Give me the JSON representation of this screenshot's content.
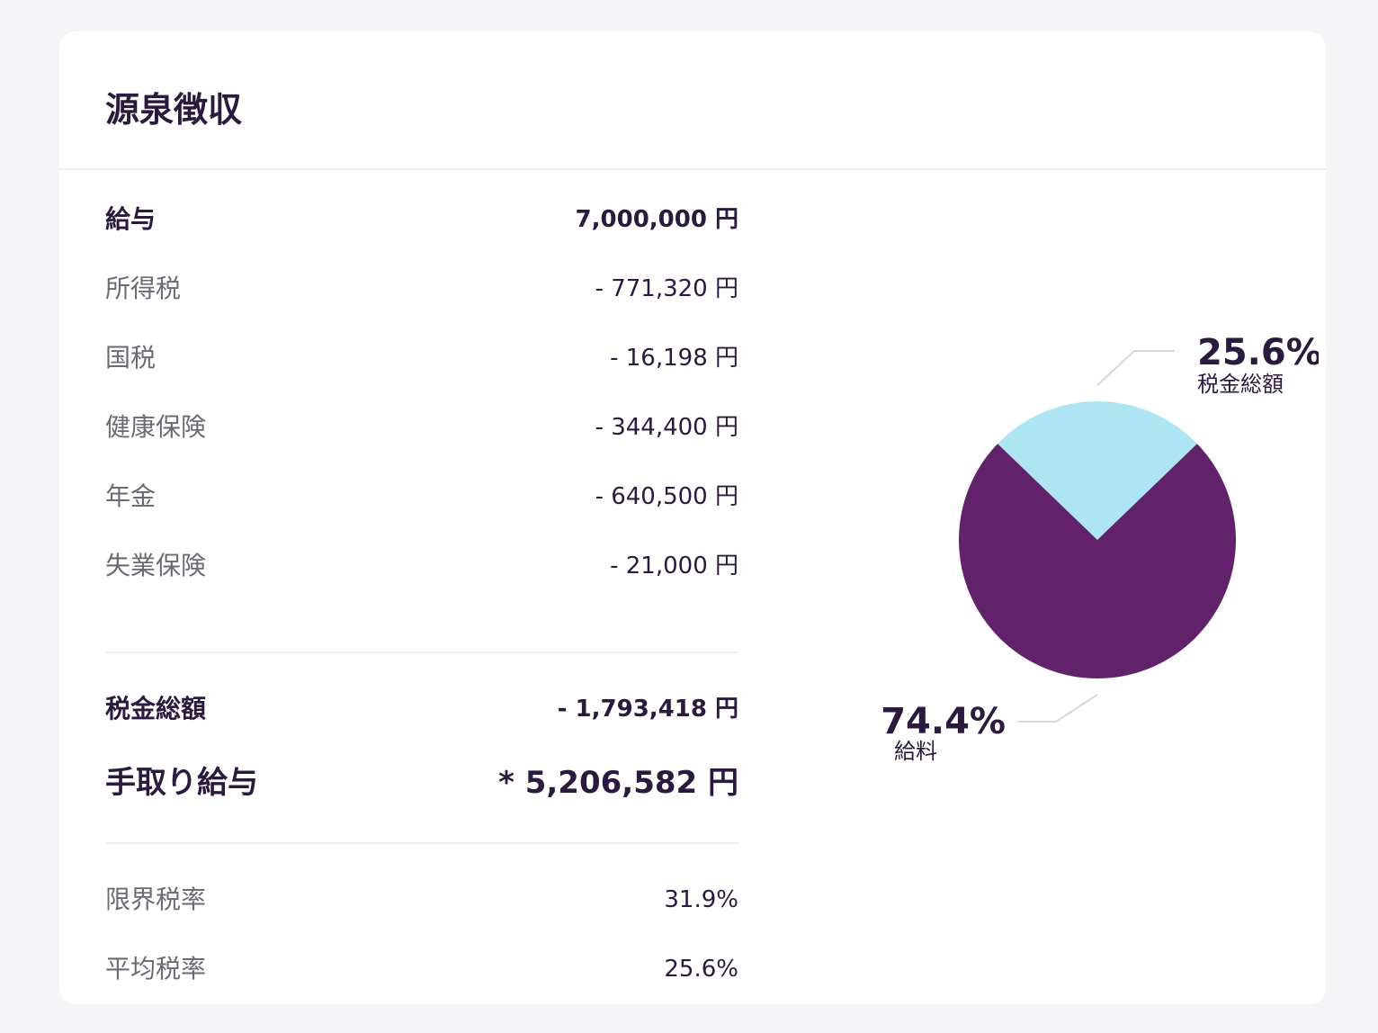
{
  "title": "源泉徴収",
  "rows": [
    {
      "label": "給与",
      "value": "7,000,000 円"
    },
    {
      "label": "所得税",
      "value": "- 771,320 円"
    },
    {
      "label": "国税",
      "value": "- 16,198 円"
    },
    {
      "label": "健康保険",
      "value": "- 344,400 円"
    },
    {
      "label": "年金",
      "value": "- 640,500 円"
    },
    {
      "label": "失業保険",
      "value": "- 21,000 円"
    }
  ],
  "totals": {
    "tax_total": {
      "label": "税金総額",
      "value": "- 1,793,418 円"
    },
    "net_pay": {
      "label": "手取り給与",
      "value": "* 5,206,582 円"
    }
  },
  "rates": [
    {
      "label": "限界税率",
      "value": "31.9%"
    },
    {
      "label": "平均税率",
      "value": "25.6%"
    }
  ],
  "colors": {
    "tax": "#ade6f2",
    "salary": "#61226b"
  },
  "chart_data": {
    "type": "pie",
    "slices": [
      {
        "name": "税金総額",
        "value": 25.6,
        "label": "25.6%",
        "color": "#ade6f2"
      },
      {
        "name": "給料",
        "value": 74.4,
        "label": "74.4%",
        "color": "#61226b"
      }
    ]
  }
}
